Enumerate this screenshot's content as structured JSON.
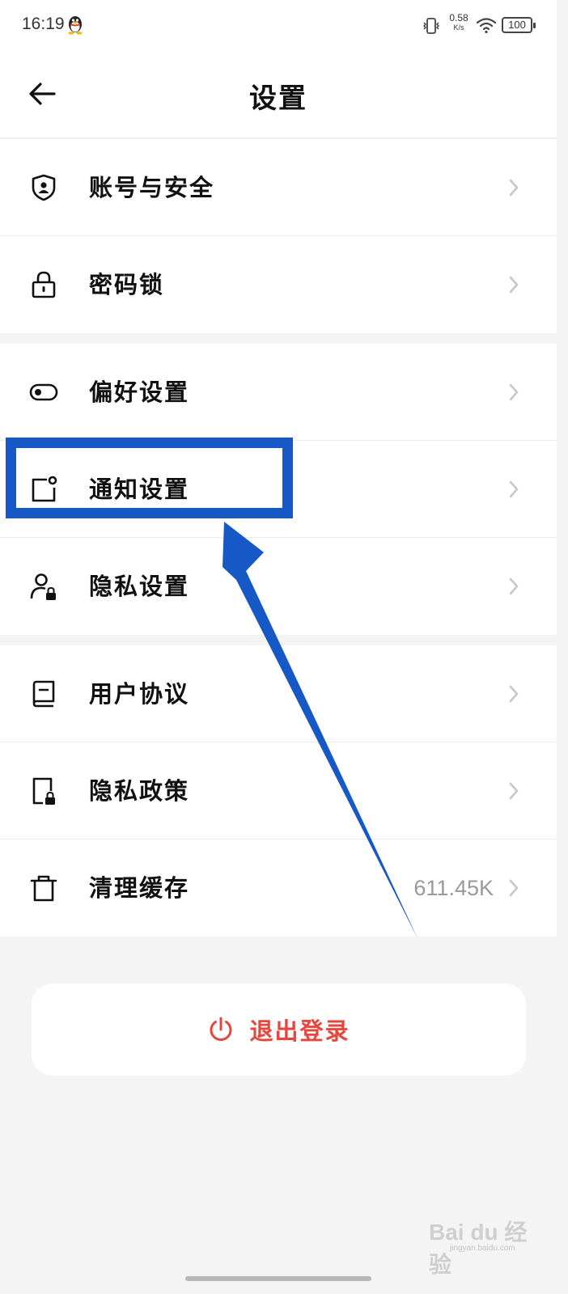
{
  "status_bar": {
    "time": "16:19",
    "net_speed_value": "0.58",
    "net_speed_unit": "K/s",
    "battery": "100"
  },
  "header": {
    "title": "设置"
  },
  "groups": [
    {
      "items": [
        {
          "label": "账号与安全",
          "icon": "shield-user-icon"
        },
        {
          "label": "密码锁",
          "icon": "lock-icon"
        }
      ]
    },
    {
      "items": [
        {
          "label": "偏好设置",
          "icon": "toggle-icon"
        },
        {
          "label": "通知设置",
          "icon": "notification-icon"
        },
        {
          "label": "隐私设置",
          "icon": "user-lock-icon"
        }
      ]
    },
    {
      "items": [
        {
          "label": "用户协议",
          "icon": "book-icon"
        },
        {
          "label": "隐私政策",
          "icon": "document-lock-icon"
        },
        {
          "label": "清理缓存",
          "icon": "trash-icon",
          "value": "611.45K"
        }
      ]
    }
  ],
  "logout": {
    "label": "退出登录",
    "icon": "power-icon",
    "color": "#e8453c"
  },
  "annotation": {
    "highlight_color": "#1659c6"
  },
  "watermark": {
    "text": "Bai du 经验",
    "sub": "jingyan.baidu.com"
  }
}
